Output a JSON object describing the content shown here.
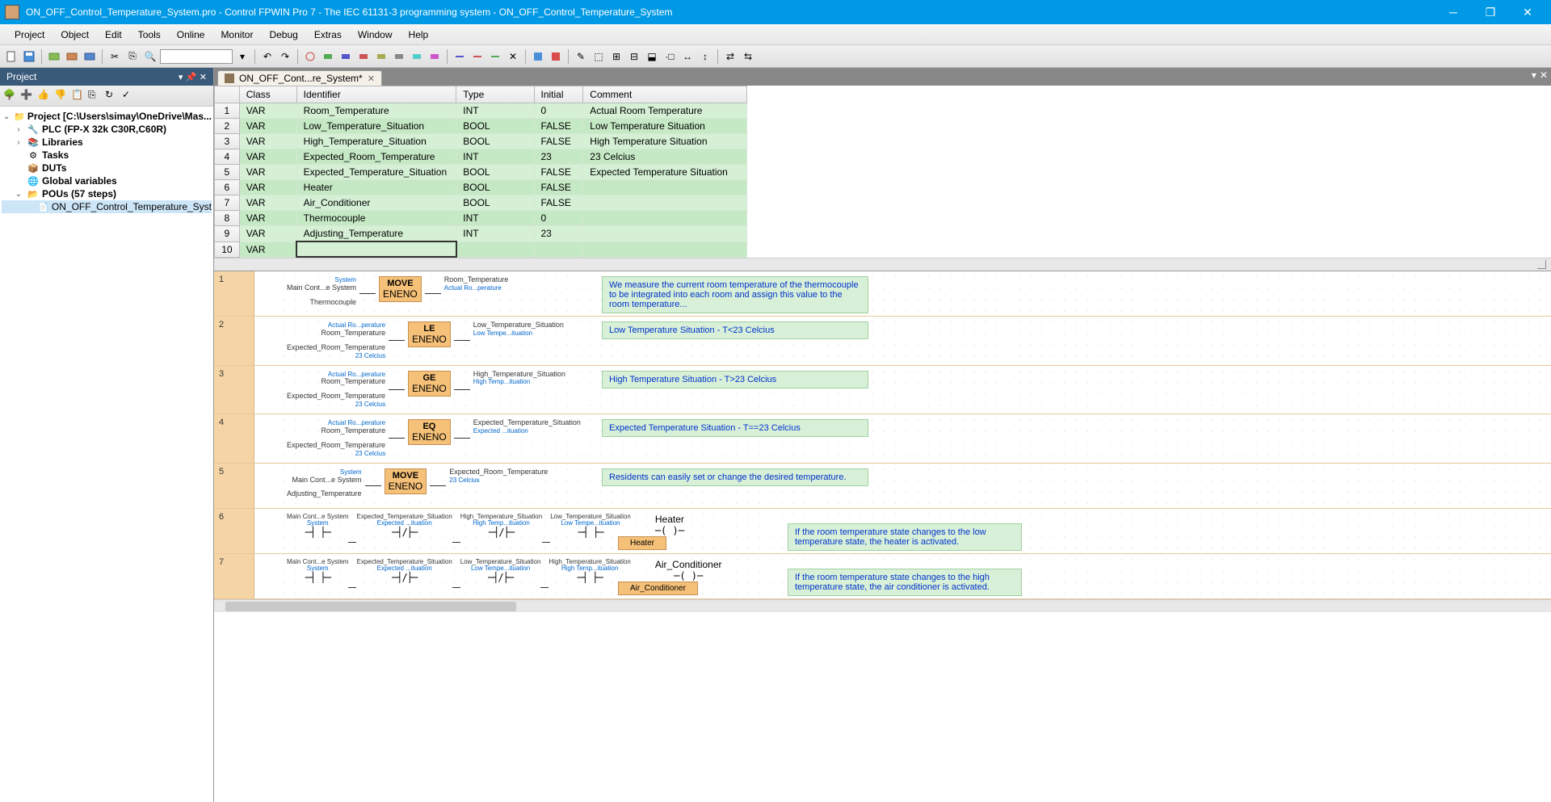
{
  "window": {
    "title": "ON_OFF_Control_Temperature_System.pro - Control FPWIN Pro 7 - The IEC 61131-3 programming system - ON_OFF_Control_Temperature_System"
  },
  "menu": {
    "items": [
      "Project",
      "Object",
      "Edit",
      "Tools",
      "Online",
      "Monitor",
      "Debug",
      "Extras",
      "Window",
      "Help"
    ]
  },
  "sidebar": {
    "title": "Project",
    "root": "Project [C:\\Users\\simay\\OneDrive\\Mas...",
    "nodes": {
      "plc": "PLC (FP-X 32k C30R,C60R)",
      "libraries": "Libraries",
      "tasks": "Tasks",
      "duts": "DUTs",
      "globals": "Global variables",
      "pous": "POUs (57 steps)",
      "pou_item": "ON_OFF_Control_Temperature_Syst"
    }
  },
  "tab": {
    "label": "ON_OFF_Cont...re_System*"
  },
  "grid": {
    "headers": {
      "class": "Class",
      "identifier": "Identifier",
      "type": "Type",
      "initial": "Initial",
      "comment": "Comment"
    },
    "rows": [
      {
        "n": "1",
        "class": "VAR",
        "id": "Room_Temperature",
        "type": "INT",
        "init": "0",
        "comment": "Actual Room Temperature"
      },
      {
        "n": "2",
        "class": "VAR",
        "id": "Low_Temperature_Situation",
        "type": "BOOL",
        "init": "FALSE",
        "comment": "Low Temperature Situation"
      },
      {
        "n": "3",
        "class": "VAR",
        "id": "High_Temperature_Situation",
        "type": "BOOL",
        "init": "FALSE",
        "comment": "High Temperature Situation"
      },
      {
        "n": "4",
        "class": "VAR",
        "id": "Expected_Room_Temperature",
        "type": "INT",
        "init": "23",
        "comment": "23 Celcius"
      },
      {
        "n": "5",
        "class": "VAR",
        "id": "Expected_Temperature_Situation",
        "type": "BOOL",
        "init": "FALSE",
        "comment": "Expected Temperature Situation"
      },
      {
        "n": "6",
        "class": "VAR",
        "id": "Heater",
        "type": "BOOL",
        "init": "FALSE",
        "comment": ""
      },
      {
        "n": "7",
        "class": "VAR",
        "id": "Air_Conditioner",
        "type": "BOOL",
        "init": "FALSE",
        "comment": ""
      },
      {
        "n": "8",
        "class": "VAR",
        "id": "Thermocouple",
        "type": "INT",
        "init": "0",
        "comment": ""
      },
      {
        "n": "9",
        "class": "VAR",
        "id": "Adjusting_Temperature",
        "type": "INT",
        "init": "23",
        "comment": ""
      },
      {
        "n": "10",
        "class": "VAR",
        "id": "",
        "type": "",
        "init": "",
        "comment": ""
      }
    ]
  },
  "ladder": {
    "rungs": [
      {
        "n": "1",
        "block": "MOVE",
        "in1": "Main Cont...e System",
        "in1b": "System",
        "in2": "Thermocouple",
        "out": "Room_Temperature",
        "outb": "Actual Ro...perature",
        "comment": "We measure the current room temperature of the thermocouple to be integrated into each room and assign this value to the room temperature..."
      },
      {
        "n": "2",
        "block": "LE",
        "in1": "Room_Temperature",
        "in1b": "Actual Ro...perature",
        "in2": "Expected_Room_Temperature",
        "in2b": "23 Celcius",
        "out": "Low_Temperature_Situation",
        "outb": "Low Tempe...ituation",
        "comment": "Low Temperature Situation - T<23 Celcius"
      },
      {
        "n": "3",
        "block": "GE",
        "in1": "Room_Temperature",
        "in1b": "Actual Ro...perature",
        "in2": "Expected_Room_Temperature",
        "in2b": "23 Celcius",
        "out": "High_Temperature_Situation",
        "outb": "High Temp...ituation",
        "comment": "High Temperature Situation - T>23 Celcius"
      },
      {
        "n": "4",
        "block": "EQ",
        "in1": "Room_Temperature",
        "in1b": "Actual Ro...perature",
        "in2": "Expected_Room_Temperature",
        "in2b": "23 Celcius",
        "out": "Expected_Temperature_Situation",
        "outb": "Expected ...ituation",
        "comment": "Expected Temperature Situation - T==23 Celcius"
      },
      {
        "n": "5",
        "block": "MOVE",
        "in1": "Main Cont...e System",
        "in1b": "System",
        "in2": "Adjusting_Temperature",
        "out": "Expected_Room_Temperature",
        "outb": "23 Celcius",
        "comment": "Residents can easily set or change the desired temperature."
      },
      {
        "n": "6",
        "contacts": [
          {
            "t": "Main Cont...e System",
            "b": "System"
          },
          {
            "t": "Expected_Temperature_Situation",
            "b": "Expected ...ituation",
            "neg": true
          },
          {
            "t": "High_Temperature_Situation",
            "b": "High Temp...ituation",
            "neg": true
          },
          {
            "t": "Low_Temperature_Situation",
            "b": "Low Tempe...ituation"
          }
        ],
        "coil": "Heater",
        "coilbox": "Heater",
        "comment": "If the room temperature state changes to the low temperature state, the heater is activated."
      },
      {
        "n": "7",
        "contacts": [
          {
            "t": "Main Cont...e System",
            "b": "System"
          },
          {
            "t": "Expected_Temperature_Situation",
            "b": "Expected ...ituation",
            "neg": true
          },
          {
            "t": "Low_Temperature_Situation",
            "b": "Low Tempe...ituation",
            "neg": true
          },
          {
            "t": "High_Temperature_Situation",
            "b": "High Temp...ituation"
          }
        ],
        "coil": "Air_Conditioner",
        "coilbox": "Air_Conditioner",
        "comment": "If the room temperature state changes to the high temperature state, the air conditioner is activated."
      }
    ]
  }
}
